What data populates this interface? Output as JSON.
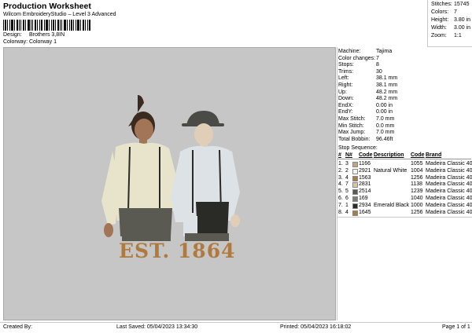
{
  "header": {
    "title": "Production Worksheet",
    "subtitle": "Wilcom EmbroideryStudio – Level 3 Advanced",
    "design_label": "Design:",
    "design_value": "Brothers 3,8IN",
    "colorway_label": "Colorway:",
    "colorway_value": "Colorway 1"
  },
  "stats": [
    {
      "label": "Stitches:",
      "value": "15745"
    },
    {
      "label": "Colors:",
      "value": "7"
    },
    {
      "label": "Height:",
      "value": "3.80 in"
    },
    {
      "label": "Width:",
      "value": "3.00 in"
    },
    {
      "label": "Zoom:",
      "value": "1:1"
    }
  ],
  "design": {
    "text": "EST. 1864",
    "background": "#c6c6c6",
    "thread_gold": "#b07a3e"
  },
  "info": [
    {
      "label": "Machine:",
      "value": "Tajima"
    },
    {
      "label": "Color changes:",
      "value": "7"
    },
    {
      "label": "Stops:",
      "value": "8"
    },
    {
      "label": "Trims:",
      "value": "30"
    },
    {
      "label": "Left:",
      "value": "38.1 mm"
    },
    {
      "label": "Right:",
      "value": "38.1 mm"
    },
    {
      "label": "Up:",
      "value": "48.2 mm"
    },
    {
      "label": "Down:",
      "value": "48.2 mm"
    },
    {
      "label": "EndX:",
      "value": "0.00 in"
    },
    {
      "label": "EndY:",
      "value": "0.00 in"
    },
    {
      "label": "Max Stitch:",
      "value": "7.0 mm"
    },
    {
      "label": "Min Stitch:",
      "value": "0.0 mm"
    },
    {
      "label": "Max Jump:",
      "value": "7.0 mm"
    },
    {
      "label": "Total Bobbin:",
      "value": "96.46ft"
    }
  ],
  "sequence": {
    "title": "Stop Sequence:",
    "headers": {
      "num": "#",
      "n": "N#",
      "code1": "Code",
      "desc": "Description",
      "code2": "Code",
      "brand": "Brand"
    },
    "rows": [
      {
        "num": "1.",
        "n": "3",
        "swatch": "#c9a27a",
        "code1": "1166",
        "desc": "",
        "code2": "1055",
        "brand": "Madeira Classic 40"
      },
      {
        "num": "2.",
        "n": "2",
        "swatch": "#f2f2ee",
        "code1": "2921",
        "desc": "Natural White",
        "code2": "1004",
        "brand": "Madeira Classic 40"
      },
      {
        "num": "3.",
        "n": "4",
        "swatch": "#b07a3e",
        "code1": "1563",
        "desc": "",
        "code2": "1256",
        "brand": "Madeira Classic 40"
      },
      {
        "num": "4.",
        "n": "7",
        "swatch": "#d7c6a2",
        "code1": "2831",
        "desc": "",
        "code2": "1138",
        "brand": "Madeira Classic 40"
      },
      {
        "num": "5.",
        "n": "5",
        "swatch": "#5a5a52",
        "code1": "2514",
        "desc": "",
        "code2": "1239",
        "brand": "Madeira Classic 40"
      },
      {
        "num": "6.",
        "n": "6",
        "swatch": "#7d7d78",
        "code1": "169",
        "desc": "",
        "code2": "1040",
        "brand": "Madeira Classic 40"
      },
      {
        "num": "7.",
        "n": "1",
        "swatch": "#2a2a26",
        "code1": "2934",
        "desc": "Emerald Black",
        "code2": "1000",
        "brand": "Madeira Classic 40"
      },
      {
        "num": "8.",
        "n": "4",
        "swatch": "#b07a3e",
        "code1": "1645",
        "desc": "",
        "code2": "1256",
        "brand": "Madeira Classic 40"
      }
    ]
  },
  "footer": {
    "created_by": "Created By:",
    "last_saved": "Last Saved: 05/04/2023 13:34:30",
    "printed": "Printed: 05/04/2023 16:18:02",
    "page": "Page 1 of 1"
  }
}
